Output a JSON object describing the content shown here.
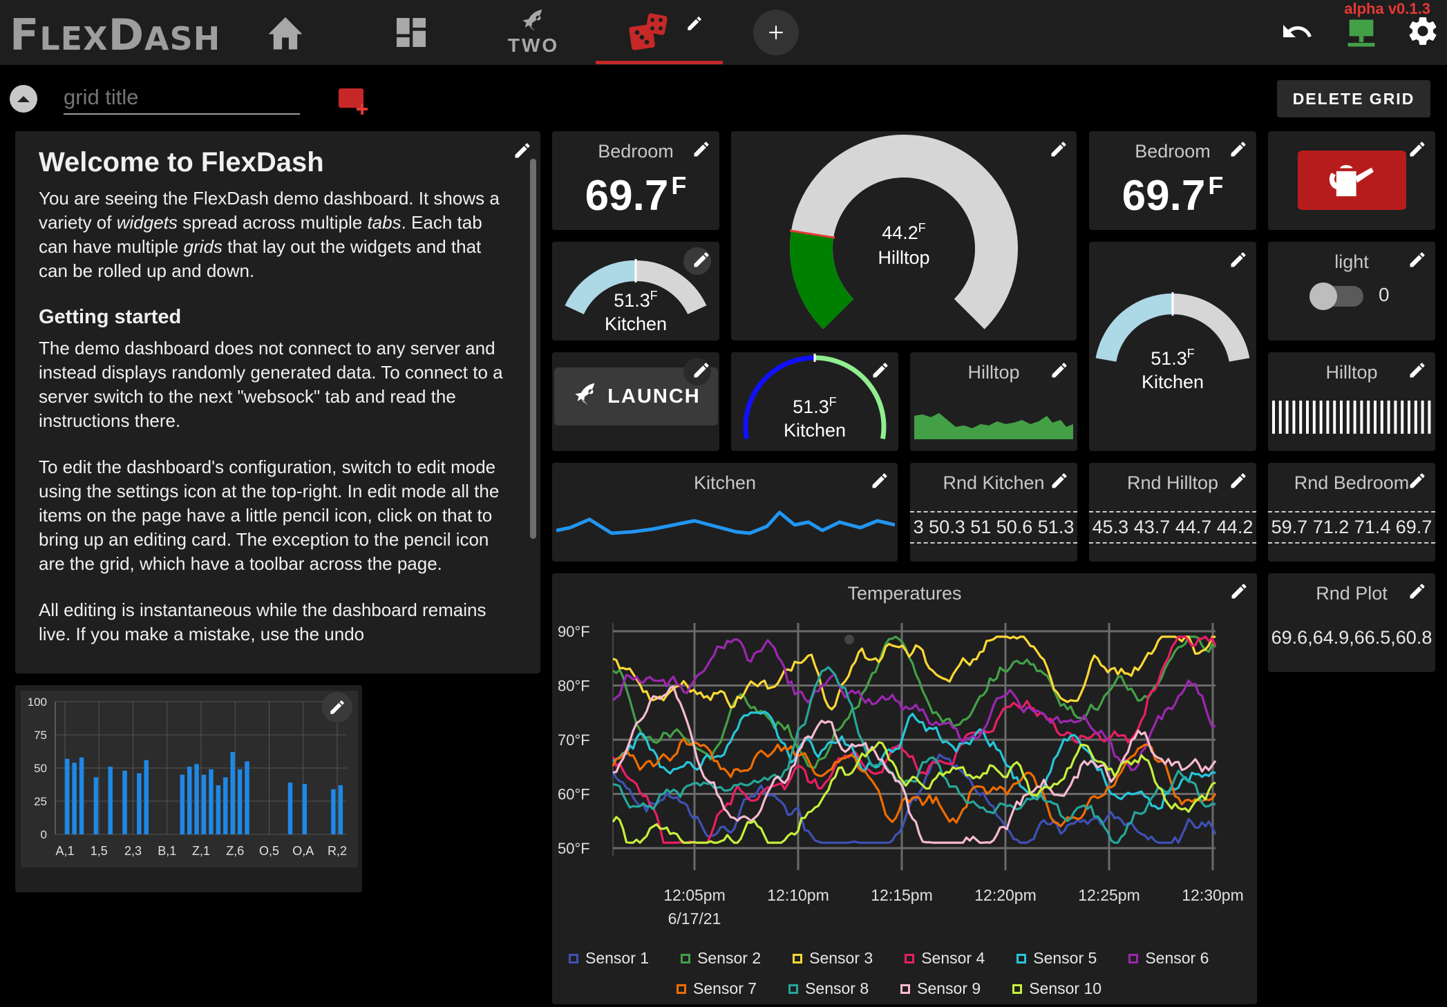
{
  "app": {
    "brand_first": "F",
    "brand_rest1": "LEX",
    "brand_mid": "D",
    "brand_rest2": "ASH",
    "version": "alpha v0.1.3"
  },
  "tabs": [
    {
      "icon": "home-icon"
    },
    {
      "icon": "dashboard-icon"
    },
    {
      "icon": "rocket-icon",
      "label": "TWO"
    },
    {
      "icon": "dice-icon",
      "active": true
    }
  ],
  "grid": {
    "title_placeholder": "grid title",
    "delete_label": "DELETE GRID"
  },
  "welcome": {
    "title": "Welcome to FlexDash",
    "p1a": "You are seeing the FlexDash demo dashboard. It shows a variety of ",
    "p1b": "widgets",
    "p1c": " spread across multiple ",
    "p1d": "tabs",
    "p1e": ". Each tab can have multiple ",
    "p1f": "grids",
    "p1g": " that lay out the widgets and that can be rolled up and down.",
    "h2": "Getting started",
    "p2": "The demo dashboard does not connect to any server and instead displays randomly generated data. To connect to a server switch to the next \"websock\" tab and read the instructions there.",
    "p3": "To edit the dashboard's configuration, switch to edit mode using the settings icon at the top-right. In edit mode all the items on the page have a little pencil icon, click on that to bring up an editing card. The exception to the pencil icon are the grid, which have a toolbar across the page.",
    "p4": "All editing is instantaneous while the dashboard remains live. If you make a mistake, use the undo"
  },
  "widgets": {
    "bedroom1": {
      "title": "Bedroom",
      "value": "69.7",
      "unit": "F"
    },
    "bedroom2": {
      "title": "Bedroom",
      "value": "69.7",
      "unit": "F"
    },
    "hilltop_gauge": {
      "value": "44.2",
      "unit": "F",
      "label": "Hilltop",
      "fraction": 0.2
    },
    "kitchen_gauge1": {
      "value": "51.3",
      "unit": "F",
      "label": "Kitchen",
      "fraction": 0.5
    },
    "kitchen_gauge2": {
      "value": "51.3",
      "unit": "F",
      "label": "Kitchen",
      "fraction": 0.5
    },
    "kitchen_gauge3": {
      "value": "51.3",
      "unit": "F",
      "label": "Kitchen",
      "fraction": 0.5
    },
    "launch": {
      "label": "LAUNCH"
    },
    "hilltop_spark": {
      "title": "Hilltop"
    },
    "hilltop_bars": {
      "title": "Hilltop"
    },
    "light": {
      "title": "light",
      "value": "0"
    },
    "kitchen_line": {
      "title": "Kitchen"
    },
    "rnd_kitchen": {
      "title": "Rnd Kitchen",
      "text": "3 50.3 51 50.6 51.3"
    },
    "rnd_hilltop": {
      "title": "Rnd Hilltop",
      "text": "45.3 43.7 44.7 44.2"
    },
    "rnd_bedroom": {
      "title": "Rnd Bedroom",
      "text": "59.7 71.2 71.4 69.7"
    },
    "rnd_plot": {
      "title": "Rnd Plot",
      "text": "69.6,64.9,66.5,60.8"
    }
  },
  "chart_data": [
    {
      "type": "bar",
      "title": "",
      "categories": [
        "A,1",
        "",
        "1,5",
        "",
        "2,3",
        "",
        "B,1",
        "",
        "Z,1",
        "",
        "Z,6",
        "",
        "O,5",
        "",
        "O,A",
        "",
        "",
        "R,2"
      ],
      "tick_labels": [
        "A,1",
        "1,5",
        "2,3",
        "B,1",
        "Z,1",
        "Z,6",
        "O,5",
        "O,A",
        "R,2"
      ],
      "values": [
        57,
        54,
        58,
        0,
        43,
        0,
        51,
        0,
        48,
        0,
        46,
        56,
        0,
        0,
        0,
        0,
        45,
        51,
        53,
        45,
        49,
        37,
        43,
        62,
        49,
        55,
        0,
        0,
        0,
        0,
        0,
        39,
        0,
        38,
        0,
        0,
        0,
        34,
        37
      ],
      "yticks": [
        0,
        25,
        50,
        75,
        100
      ],
      "ylim": [
        0,
        100
      ],
      "color": "#1e88e5"
    },
    {
      "type": "line",
      "title": "Temperatures",
      "x_ticks": [
        "12:05pm",
        "12:10pm",
        "12:15pm",
        "12:20pm",
        "12:25pm",
        "12:30pm"
      ],
      "x_date": "6/17/21",
      "y_ticks": [
        "90°F",
        "80°F",
        "70°F",
        "60°F",
        "50°F"
      ],
      "ylim": [
        50,
        90
      ],
      "series": [
        {
          "name": "Sensor 1",
          "color": "#3f51b5",
          "start": 64,
          "end": 56
        },
        {
          "name": "Sensor 2",
          "color": "#43a047",
          "start": 84,
          "end": 81
        },
        {
          "name": "Sensor 3",
          "color": "#fdd835",
          "start": 85,
          "end": 80
        },
        {
          "name": "Sensor 4",
          "color": "#e91e63",
          "start": 67,
          "end": 82
        },
        {
          "name": "Sensor 5",
          "color": "#26c6da",
          "start": 66,
          "end": 78
        },
        {
          "name": "Sensor 6",
          "color": "#9c27b0",
          "start": 76,
          "end": 75
        },
        {
          "name": "Sensor 7",
          "color": "#ef6c00",
          "start": 64,
          "end": 69
        },
        {
          "name": "Sensor 8",
          "color": "#26a69a",
          "start": 62,
          "end": 65
        },
        {
          "name": "Sensor 9",
          "color": "#f8bbd0",
          "start": 63,
          "end": 66
        },
        {
          "name": "Sensor 10",
          "color": "#c6ef3c",
          "start": 54,
          "end": 60
        }
      ]
    }
  ],
  "colors": {
    "accent_red": "#c62828",
    "status_green": "#43a047",
    "gauge_grey": "#d6d6d6",
    "gauge_lightblue": "#add8e6"
  }
}
